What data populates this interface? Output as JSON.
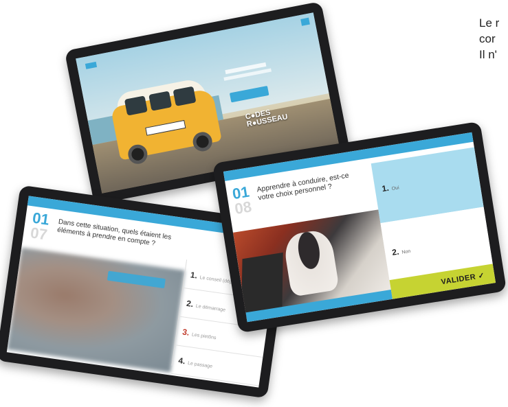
{
  "side_text": {
    "line1": "Le r",
    "line2": "cor",
    "line3": "Il n'"
  },
  "tablet_home": {
    "brand_line1": "C●DES",
    "brand_line2": "R●USSEAU"
  },
  "tablet_left": {
    "number_current": "01",
    "number_next": "07",
    "question": "Dans cette situation, quels étaient les éléments à prendre en compte ?",
    "answers": [
      {
        "num": "1.",
        "label": "Le conseil (dép"
      },
      {
        "num": "2.",
        "label": "Le démarrage"
      },
      {
        "num": "3.",
        "label": "Les pietôns"
      },
      {
        "num": "4.",
        "label": "Le passage"
      }
    ]
  },
  "tablet_right": {
    "number_current": "01",
    "number_next": "08",
    "question": "Apprendre à conduire, est-ce votre choix personnel ?",
    "answer_a_num": "1.",
    "answer_a_label": "Oui",
    "answer_b_num": "2.",
    "answer_b_label": "Non",
    "validate_label": "VALIDER ✓"
  },
  "colors": {
    "accent_blue": "#3aa8d8",
    "validate_green": "#c6d332",
    "answer_highlight": "#a9dcef"
  }
}
